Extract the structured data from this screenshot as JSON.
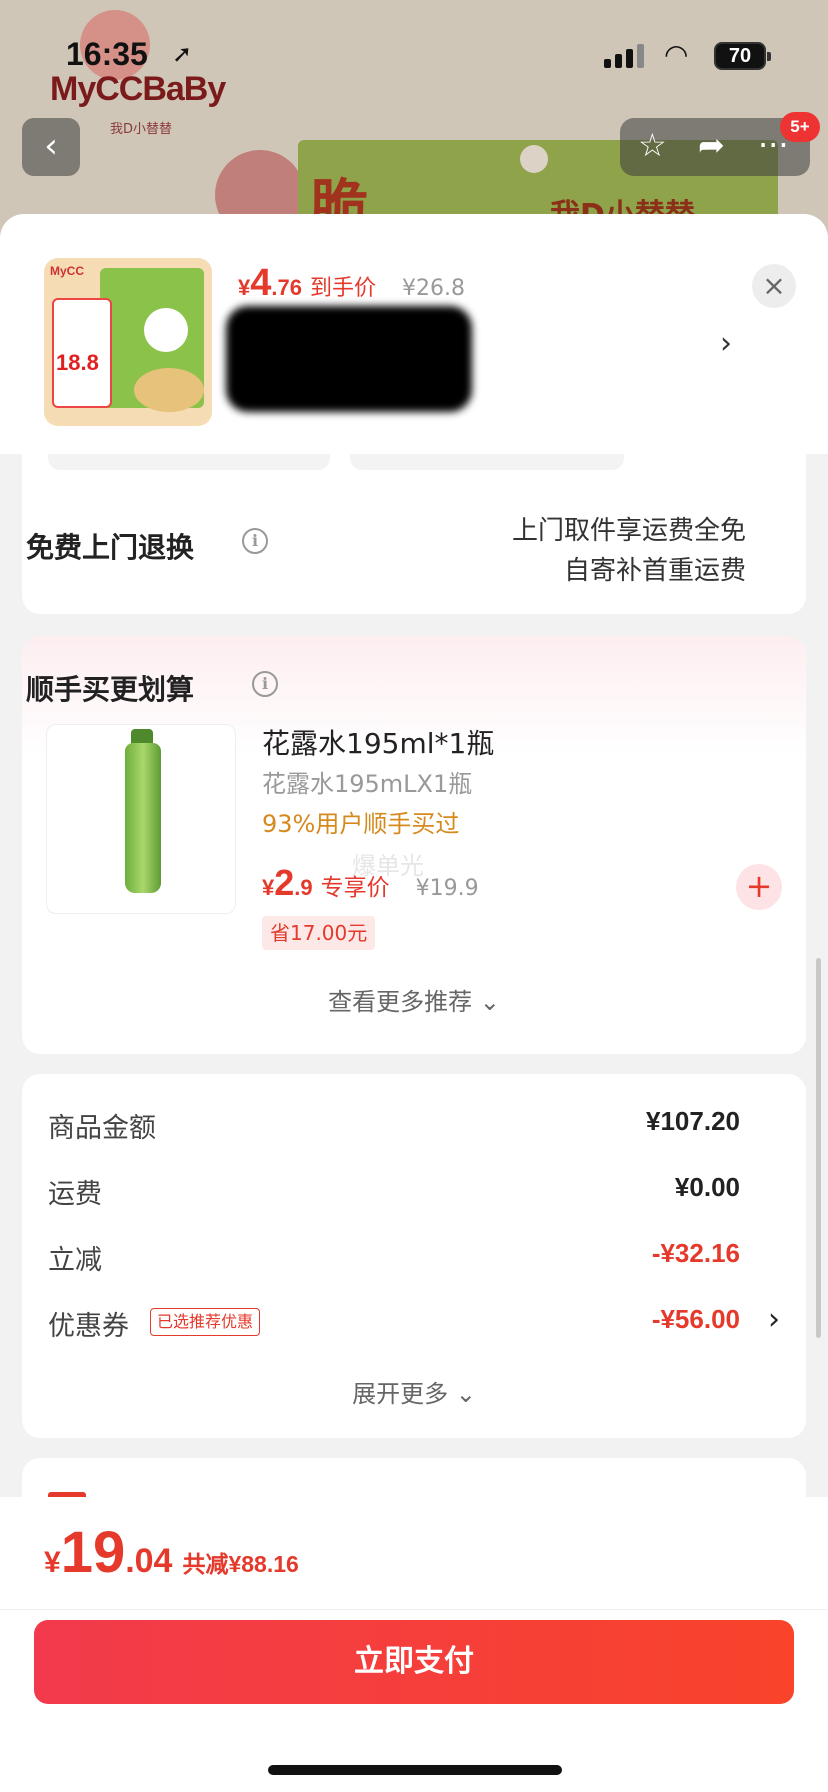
{
  "status_bar": {
    "time": "16:35",
    "battery": "70"
  },
  "background": {
    "logo_text": "MyCCBaBy",
    "logo_sub": "我D小替替",
    "box_text": "脆",
    "box_text2": "我D小替替",
    "cart_badge": "5+"
  },
  "header": {
    "price_symbol": "¥",
    "price_int": "4",
    "price_dec": ".76",
    "price_tag": "到手价",
    "original_price": "¥26.8",
    "thumb_label": "MyCC",
    "thumb_price": "18.8"
  },
  "return_card": {
    "title": "免费上门退换",
    "line1": "上门取件享运费全免",
    "line2": "自寄补首重运费"
  },
  "reco_card": {
    "title": "顺手买更划算",
    "product_name": "花露水195ml*1瓶",
    "spec": "花露水195mLX1瓶",
    "bought_pct": "93%用户顺手买过",
    "watermark": "爆单光",
    "price_symbol": "¥",
    "price_int": "2",
    "price_dec": ".9",
    "price_tag": "专享价",
    "original_price": "¥19.9",
    "save_text": "省17.00元",
    "more_label": "查看更多推荐 ⌄"
  },
  "summary": {
    "rows": [
      {
        "label": "商品金额",
        "value": "¥107.20"
      },
      {
        "label": "运费",
        "value": "¥0.00"
      },
      {
        "label": "立减",
        "value": "-¥32.16"
      },
      {
        "label": "优惠券",
        "value": "-¥56.00",
        "tag": "已选推荐优惠"
      }
    ],
    "expand_label": "展开更多 ⌄"
  },
  "footer": {
    "total_symbol": "¥",
    "total_int": "19",
    "total_dec": ".04",
    "total_saved": "共减¥88.16",
    "pay_label": "立即支付"
  },
  "colors": {
    "accent": "#e4392b",
    "pay_start": "#f23a4c",
    "pay_end": "#f9432a",
    "badge_text": "#d68a1e"
  },
  "icons": [
    "location-arrow-icon",
    "signal-icon",
    "wifi-icon",
    "battery-icon",
    "back-icon",
    "star-icon",
    "share-icon",
    "more-icon",
    "close-icon",
    "chevron-right-icon",
    "info-icon",
    "plus-icon",
    "chevron-down-icon"
  ]
}
